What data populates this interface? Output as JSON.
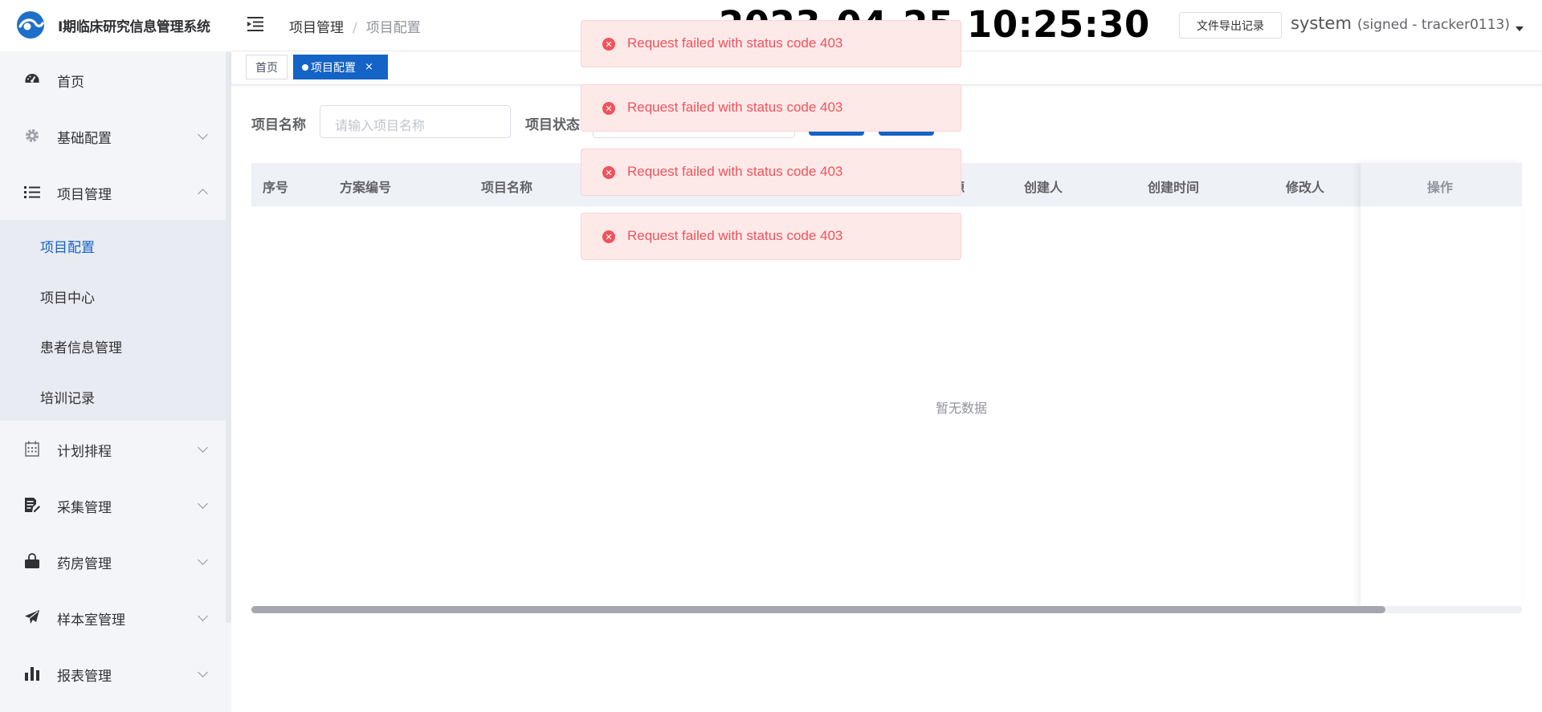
{
  "app": {
    "title": "I期临床研究信息管理系统"
  },
  "sidebar": {
    "items": [
      {
        "label": "首页",
        "icon": "dashboard-icon"
      },
      {
        "label": "基础配置",
        "icon": "gear-icon"
      },
      {
        "label": "项目管理",
        "icon": "list-icon",
        "expanded": true,
        "children": [
          {
            "label": "项目配置",
            "active": true
          },
          {
            "label": "项目中心"
          },
          {
            "label": "患者信息管理"
          },
          {
            "label": "培训记录"
          }
        ]
      },
      {
        "label": "计划排程",
        "icon": "calendar-icon"
      },
      {
        "label": "采集管理",
        "icon": "edit-document-icon"
      },
      {
        "label": "药房管理",
        "icon": "bag-icon"
      },
      {
        "label": "样本室管理",
        "icon": "send-icon"
      },
      {
        "label": "报表管理",
        "icon": "bar-chart-icon"
      }
    ]
  },
  "header": {
    "breadcrumb": [
      "项目管理",
      "项目配置"
    ],
    "clock": "2023-04-25 10:25:30",
    "export_button": "文件导出记录",
    "user_name": "system",
    "user_signed": "(signed - tracker0113)"
  },
  "tags": {
    "home": "首页",
    "active": "项目配置",
    "close_glyph": "×"
  },
  "search": {
    "name_label": "项目名称",
    "name_placeholder": "请输入项目名称",
    "status_label": "项目状态"
  },
  "table": {
    "columns": [
      "序号",
      "方案编号",
      "项目名称",
      "来源",
      "创建人",
      "创建时间",
      "修改人"
    ],
    "fixed_column": "操作",
    "empty_text": "暂无数据"
  },
  "toasts": [
    "Request failed with status code 403",
    "Request failed with status code 403",
    "Request failed with status code 403",
    "Request failed with status code 403"
  ],
  "colors": {
    "primary": "#1463c6",
    "error": "#f0535c",
    "error_bg": "#fee9e9",
    "sidebar_bg": "#f4f5f9"
  }
}
